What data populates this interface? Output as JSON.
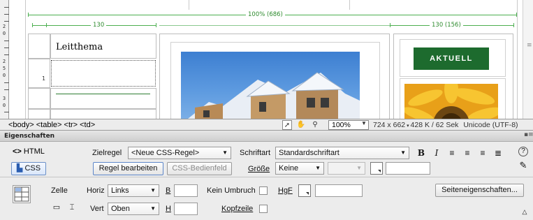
{
  "design": {
    "guide_total": "100% (686)",
    "guide_left": "130",
    "guide_right": "130 (156)",
    "vertical_ruler_labels": [
      "2",
      "0",
      "2",
      "5",
      "0",
      "3",
      "0"
    ],
    "leitthema": "Leitthema",
    "row_number": "1",
    "aktuell": "AKTUELL"
  },
  "status_bar": {
    "tag_selector": "<body> <table> <tr> <td>",
    "zoom": "100%",
    "dimensions": "724 x 662",
    "size_time": "428 K / 62 Sek",
    "encoding": "Unicode (UTF-8)"
  },
  "panel": {
    "title": "Eigenschaften",
    "html_label": "HTML",
    "css_label": "CSS",
    "zielregel_label": "Zielregel",
    "zielregel_value": "<Neue CSS-Regel>",
    "regel_button": "Regel bearbeiten",
    "css_panel_button": "CSS-Bedienfeld",
    "schriftart_label": "Schriftart",
    "schriftart_value": "Standardschriftart",
    "groesse_label": "Größe",
    "groesse_value": "Keine",
    "bold": "B",
    "italic": "I",
    "zelle_label": "Zelle",
    "horiz_label": "Horiz",
    "horiz_value": "Links",
    "vert_label": "Vert",
    "vert_value": "Oben",
    "b_label": "B",
    "h_label": "H",
    "kein_umbruch_label": "Kein Umbruch",
    "hgf_label": "HgF",
    "kopfzeile_label": "Kopfzeile",
    "seiteneigenschaften_button": "Seiteneigenschaften..."
  },
  "colors": {
    "guide_green": "#4caf50",
    "aktuell_bg": "#1d6b2e"
  }
}
